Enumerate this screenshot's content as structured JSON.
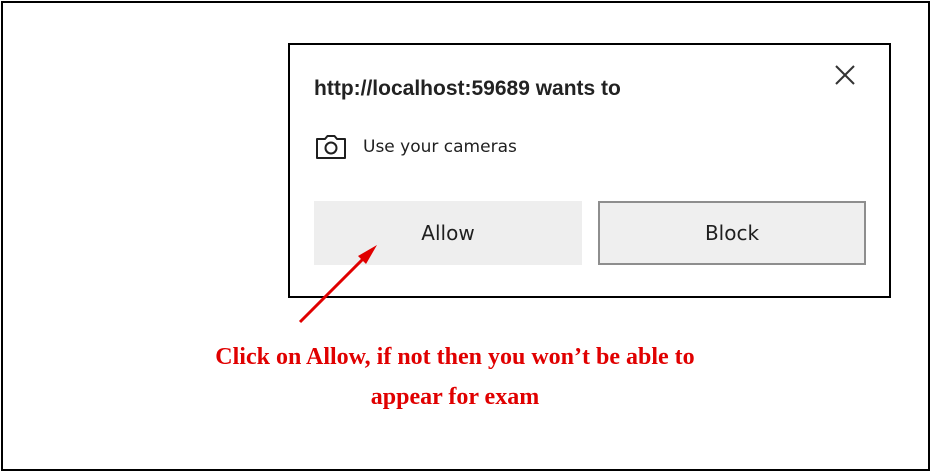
{
  "dialog": {
    "origin": "http://localhost:59689 wants to",
    "permission": {
      "icon": "camera-icon",
      "label": "Use your cameras"
    },
    "allow_label": "Allow",
    "block_label": "Block",
    "close_icon": "close-icon"
  },
  "annotation": {
    "line1": "Click on Allow, if not then you won’t be able to",
    "line2": "appear for exam",
    "color": "#e00000"
  }
}
